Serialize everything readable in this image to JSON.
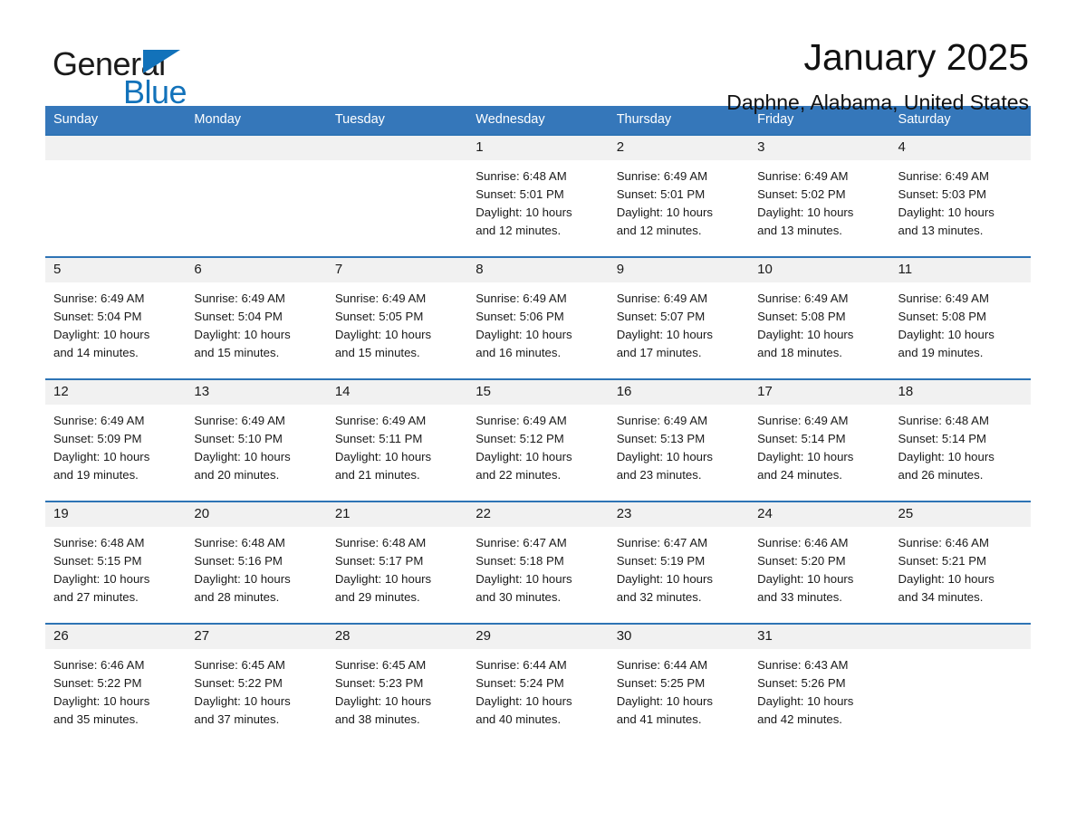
{
  "brand": {
    "name_part1": "General",
    "name_part2": "Blue",
    "accent_color": "#1272BA",
    "logo_icon": "triangle-flag-icon"
  },
  "header": {
    "month_title": "January 2025",
    "location": "Daphne, Alabama, United States"
  },
  "theme": {
    "header_blue": "#3577BA",
    "row_rule_blue": "#2E74B5",
    "daynum_band": "#F1F1F1",
    "text": "#1a1a1a"
  },
  "weekday_headers": [
    "Sunday",
    "Monday",
    "Tuesday",
    "Wednesday",
    "Thursday",
    "Friday",
    "Saturday"
  ],
  "weeks": [
    [
      {
        "day": "",
        "sunrise": "",
        "sunset": "",
        "daylight_line1": "",
        "daylight_line2": "",
        "blank": true
      },
      {
        "day": "",
        "sunrise": "",
        "sunset": "",
        "daylight_line1": "",
        "daylight_line2": "",
        "blank": true
      },
      {
        "day": "",
        "sunrise": "",
        "sunset": "",
        "daylight_line1": "",
        "daylight_line2": "",
        "blank": true
      },
      {
        "day": "1",
        "sunrise": "Sunrise: 6:48 AM",
        "sunset": "Sunset: 5:01 PM",
        "daylight_line1": "Daylight: 10 hours",
        "daylight_line2": "and 12 minutes.",
        "blank": false
      },
      {
        "day": "2",
        "sunrise": "Sunrise: 6:49 AM",
        "sunset": "Sunset: 5:01 PM",
        "daylight_line1": "Daylight: 10 hours",
        "daylight_line2": "and 12 minutes.",
        "blank": false
      },
      {
        "day": "3",
        "sunrise": "Sunrise: 6:49 AM",
        "sunset": "Sunset: 5:02 PM",
        "daylight_line1": "Daylight: 10 hours",
        "daylight_line2": "and 13 minutes.",
        "blank": false
      },
      {
        "day": "4",
        "sunrise": "Sunrise: 6:49 AM",
        "sunset": "Sunset: 5:03 PM",
        "daylight_line1": "Daylight: 10 hours",
        "daylight_line2": "and 13 minutes.",
        "blank": false
      }
    ],
    [
      {
        "day": "5",
        "sunrise": "Sunrise: 6:49 AM",
        "sunset": "Sunset: 5:04 PM",
        "daylight_line1": "Daylight: 10 hours",
        "daylight_line2": "and 14 minutes.",
        "blank": false
      },
      {
        "day": "6",
        "sunrise": "Sunrise: 6:49 AM",
        "sunset": "Sunset: 5:04 PM",
        "daylight_line1": "Daylight: 10 hours",
        "daylight_line2": "and 15 minutes.",
        "blank": false
      },
      {
        "day": "7",
        "sunrise": "Sunrise: 6:49 AM",
        "sunset": "Sunset: 5:05 PM",
        "daylight_line1": "Daylight: 10 hours",
        "daylight_line2": "and 15 minutes.",
        "blank": false
      },
      {
        "day": "8",
        "sunrise": "Sunrise: 6:49 AM",
        "sunset": "Sunset: 5:06 PM",
        "daylight_line1": "Daylight: 10 hours",
        "daylight_line2": "and 16 minutes.",
        "blank": false
      },
      {
        "day": "9",
        "sunrise": "Sunrise: 6:49 AM",
        "sunset": "Sunset: 5:07 PM",
        "daylight_line1": "Daylight: 10 hours",
        "daylight_line2": "and 17 minutes.",
        "blank": false
      },
      {
        "day": "10",
        "sunrise": "Sunrise: 6:49 AM",
        "sunset": "Sunset: 5:08 PM",
        "daylight_line1": "Daylight: 10 hours",
        "daylight_line2": "and 18 minutes.",
        "blank": false
      },
      {
        "day": "11",
        "sunrise": "Sunrise: 6:49 AM",
        "sunset": "Sunset: 5:08 PM",
        "daylight_line1": "Daylight: 10 hours",
        "daylight_line2": "and 19 minutes.",
        "blank": false
      }
    ],
    [
      {
        "day": "12",
        "sunrise": "Sunrise: 6:49 AM",
        "sunset": "Sunset: 5:09 PM",
        "daylight_line1": "Daylight: 10 hours",
        "daylight_line2": "and 19 minutes.",
        "blank": false
      },
      {
        "day": "13",
        "sunrise": "Sunrise: 6:49 AM",
        "sunset": "Sunset: 5:10 PM",
        "daylight_line1": "Daylight: 10 hours",
        "daylight_line2": "and 20 minutes.",
        "blank": false
      },
      {
        "day": "14",
        "sunrise": "Sunrise: 6:49 AM",
        "sunset": "Sunset: 5:11 PM",
        "daylight_line1": "Daylight: 10 hours",
        "daylight_line2": "and 21 minutes.",
        "blank": false
      },
      {
        "day": "15",
        "sunrise": "Sunrise: 6:49 AM",
        "sunset": "Sunset: 5:12 PM",
        "daylight_line1": "Daylight: 10 hours",
        "daylight_line2": "and 22 minutes.",
        "blank": false
      },
      {
        "day": "16",
        "sunrise": "Sunrise: 6:49 AM",
        "sunset": "Sunset: 5:13 PM",
        "daylight_line1": "Daylight: 10 hours",
        "daylight_line2": "and 23 minutes.",
        "blank": false
      },
      {
        "day": "17",
        "sunrise": "Sunrise: 6:49 AM",
        "sunset": "Sunset: 5:14 PM",
        "daylight_line1": "Daylight: 10 hours",
        "daylight_line2": "and 24 minutes.",
        "blank": false
      },
      {
        "day": "18",
        "sunrise": "Sunrise: 6:48 AM",
        "sunset": "Sunset: 5:14 PM",
        "daylight_line1": "Daylight: 10 hours",
        "daylight_line2": "and 26 minutes.",
        "blank": false
      }
    ],
    [
      {
        "day": "19",
        "sunrise": "Sunrise: 6:48 AM",
        "sunset": "Sunset: 5:15 PM",
        "daylight_line1": "Daylight: 10 hours",
        "daylight_line2": "and 27 minutes.",
        "blank": false
      },
      {
        "day": "20",
        "sunrise": "Sunrise: 6:48 AM",
        "sunset": "Sunset: 5:16 PM",
        "daylight_line1": "Daylight: 10 hours",
        "daylight_line2": "and 28 minutes.",
        "blank": false
      },
      {
        "day": "21",
        "sunrise": "Sunrise: 6:48 AM",
        "sunset": "Sunset: 5:17 PM",
        "daylight_line1": "Daylight: 10 hours",
        "daylight_line2": "and 29 minutes.",
        "blank": false
      },
      {
        "day": "22",
        "sunrise": "Sunrise: 6:47 AM",
        "sunset": "Sunset: 5:18 PM",
        "daylight_line1": "Daylight: 10 hours",
        "daylight_line2": "and 30 minutes.",
        "blank": false
      },
      {
        "day": "23",
        "sunrise": "Sunrise: 6:47 AM",
        "sunset": "Sunset: 5:19 PM",
        "daylight_line1": "Daylight: 10 hours",
        "daylight_line2": "and 32 minutes.",
        "blank": false
      },
      {
        "day": "24",
        "sunrise": "Sunrise: 6:46 AM",
        "sunset": "Sunset: 5:20 PM",
        "daylight_line1": "Daylight: 10 hours",
        "daylight_line2": "and 33 minutes.",
        "blank": false
      },
      {
        "day": "25",
        "sunrise": "Sunrise: 6:46 AM",
        "sunset": "Sunset: 5:21 PM",
        "daylight_line1": "Daylight: 10 hours",
        "daylight_line2": "and 34 minutes.",
        "blank": false
      }
    ],
    [
      {
        "day": "26",
        "sunrise": "Sunrise: 6:46 AM",
        "sunset": "Sunset: 5:22 PM",
        "daylight_line1": "Daylight: 10 hours",
        "daylight_line2": "and 35 minutes.",
        "blank": false
      },
      {
        "day": "27",
        "sunrise": "Sunrise: 6:45 AM",
        "sunset": "Sunset: 5:22 PM",
        "daylight_line1": "Daylight: 10 hours",
        "daylight_line2": "and 37 minutes.",
        "blank": false
      },
      {
        "day": "28",
        "sunrise": "Sunrise: 6:45 AM",
        "sunset": "Sunset: 5:23 PM",
        "daylight_line1": "Daylight: 10 hours",
        "daylight_line2": "and 38 minutes.",
        "blank": false
      },
      {
        "day": "29",
        "sunrise": "Sunrise: 6:44 AM",
        "sunset": "Sunset: 5:24 PM",
        "daylight_line1": "Daylight: 10 hours",
        "daylight_line2": "and 40 minutes.",
        "blank": false
      },
      {
        "day": "30",
        "sunrise": "Sunrise: 6:44 AM",
        "sunset": "Sunset: 5:25 PM",
        "daylight_line1": "Daylight: 10 hours",
        "daylight_line2": "and 41 minutes.",
        "blank": false
      },
      {
        "day": "31",
        "sunrise": "Sunrise: 6:43 AM",
        "sunset": "Sunset: 5:26 PM",
        "daylight_line1": "Daylight: 10 hours",
        "daylight_line2": "and 42 minutes.",
        "blank": false
      },
      {
        "day": "",
        "sunrise": "",
        "sunset": "",
        "daylight_line1": "",
        "daylight_line2": "",
        "blank": true
      }
    ]
  ]
}
